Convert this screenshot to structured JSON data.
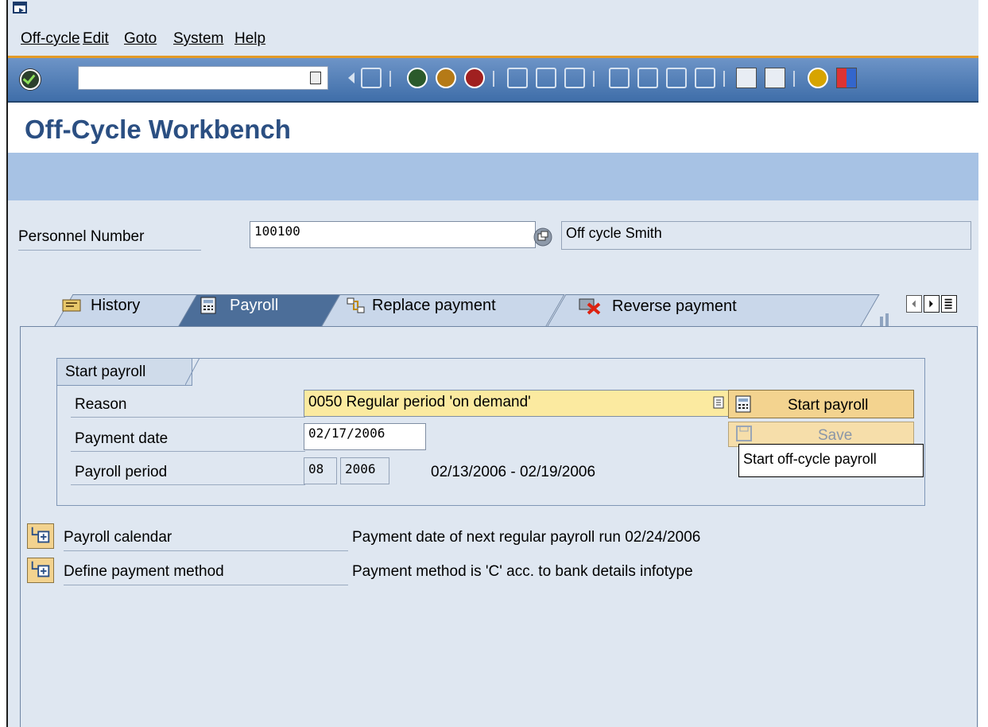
{
  "menu": {
    "items": [
      "Off-cycle",
      "Edit",
      "Goto",
      "System",
      "Help"
    ]
  },
  "toolbar": {
    "command_field": ""
  },
  "header": {
    "title": "Off-Cycle Workbench"
  },
  "personnel": {
    "label": "Personnel Number",
    "number": "100100",
    "name": "Off cycle Smith"
  },
  "tabs": [
    {
      "label": "History",
      "icon": "history-icon"
    },
    {
      "label": "Payroll",
      "icon": "calculator-icon"
    },
    {
      "label": "Replace payment",
      "icon": "replace-icon"
    },
    {
      "label": "Reverse payment",
      "icon": "reverse-icon"
    }
  ],
  "start_payroll": {
    "group_title": "Start payroll",
    "reason_label": "Reason",
    "reason_value": "0050 Regular period 'on demand'",
    "payment_date_label": "Payment date",
    "payment_date_value": "02/17/2006",
    "payroll_period_label": "Payroll period",
    "period_number": "08",
    "period_year": "2006",
    "period_range": "02/13/2006 - 02/19/2006",
    "start_button": "Start payroll",
    "save_button": "Save",
    "tooltip": "Start off-cycle payroll"
  },
  "links": {
    "calendar_label": "Payroll calendar",
    "calendar_info": "Payment date of next regular payroll run 02/24/2006",
    "payment_method_label": "Define payment method",
    "payment_method_info": "Payment method is 'C' acc. to bank details infotype"
  }
}
